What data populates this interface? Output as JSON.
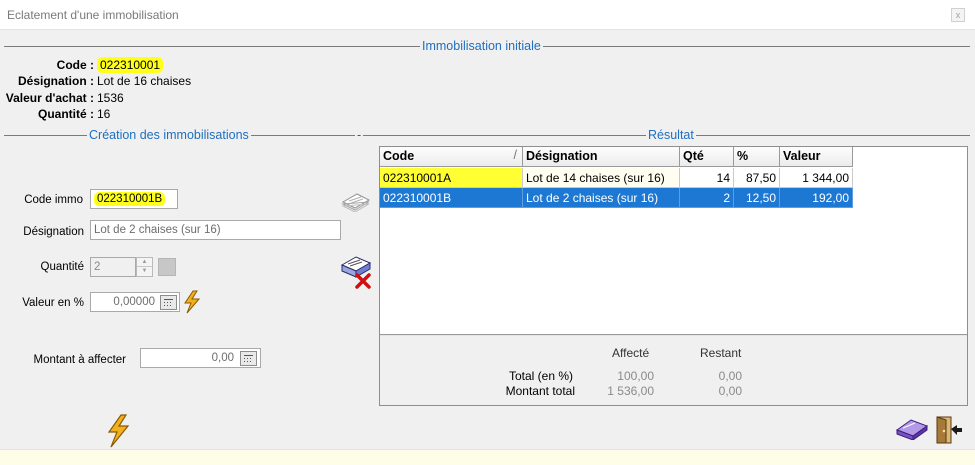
{
  "window": {
    "title": "Eclatement d'une immobilisation",
    "close_glyph": "x"
  },
  "sections": {
    "initiale": "Immobilisation initiale",
    "creation": "Création des immobilisations",
    "dash": "-",
    "resultat": "Résultat"
  },
  "initiale": {
    "code_label": "Code :",
    "code_value": "022310001",
    "designation_label": "Désignation :",
    "designation_value": "Lot de 16 chaises",
    "valeur_label": "Valeur d'achat :",
    "valeur_value": "1536",
    "quantite_label": "Quantité :",
    "quantite_value": "16"
  },
  "form": {
    "code_immo_label": "Code immo",
    "code_immo_value": "022310001B",
    "designation_label": "Désignation",
    "designation_value": "Lot de 2 chaises (sur 16)",
    "quantite_label": "Quantité",
    "quantite_value": "2",
    "valeur_pct_label": "Valeur en %",
    "valeur_pct_value": "0,00000",
    "montant_label": "Montant à affecter",
    "montant_value": "0,00"
  },
  "grid": {
    "columns": [
      "Code",
      "Désignation",
      "Qté",
      "%",
      "Valeur"
    ],
    "sort_glyph": "/",
    "rows": [
      {
        "code": "022310001A",
        "designation": "Lot de 14 chaises (sur 16)",
        "qte": "14",
        "pct": "87,50",
        "valeur": "1 344,00"
      },
      {
        "code": "022310001B",
        "designation": "Lot de 2 chaises (sur 16)",
        "qte": "2",
        "pct": "12,50",
        "valeur": "192,00"
      }
    ]
  },
  "totals": {
    "affecte_header": "Affecté",
    "restant_header": "Restant",
    "total_pct_label": "Total (en %)",
    "total_pct_affecte": "100,00",
    "total_pct_restant": "0,00",
    "montant_total_label": "Montant total",
    "montant_total_affecte": "1 536,00",
    "montant_total_restant": "0,00"
  },
  "colors": {
    "section_title": "#1e6fc0",
    "highlight": "#ffff1a",
    "selection": "#1d78d3",
    "lightning": "#f2b01e"
  },
  "icons": [
    "paper-stack-icon",
    "delete-document-icon",
    "lightning-icon",
    "calculator-icon",
    "eraser-icon",
    "exit-door-icon"
  ]
}
